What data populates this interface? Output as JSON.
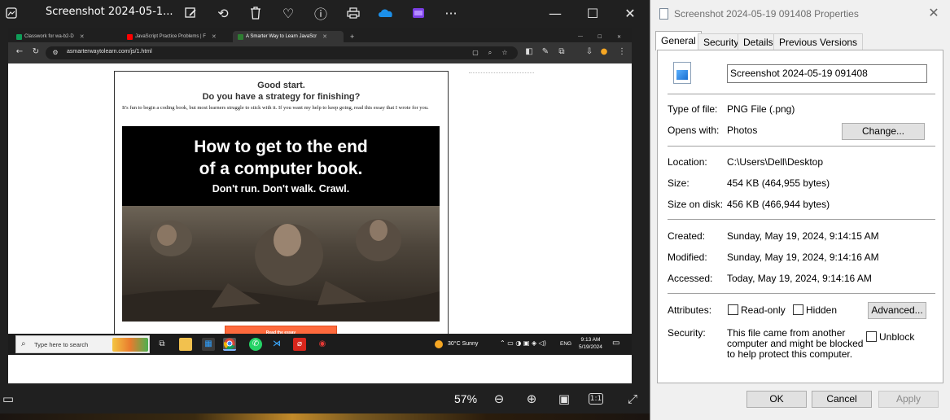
{
  "viewer": {
    "title": "Screenshot 2024-05-1...",
    "zoom": "57%",
    "icons": {
      "gallery": "gallery-icon",
      "edit": "edit-icon",
      "rotate": "rotate-icon",
      "delete": "delete-icon",
      "favorite": "heart-icon",
      "info": "info-icon",
      "print": "print-icon",
      "onedrive": "cloud-icon",
      "clipchamp": "clipchamp-icon",
      "more": "more-icon",
      "zoom_out": "zoom-out-icon",
      "zoom_in": "zoom-in-icon",
      "fit": "fit-icon",
      "actual_size": "actual-size-icon",
      "fullscreen": "fullscreen-icon",
      "filmstrip": "filmstrip-icon"
    },
    "actual_size_label": "1:1"
  },
  "browser": {
    "tabs": [
      {
        "label": "Classwork for wa-b2-D",
        "favicon_color": "#0f9d58"
      },
      {
        "label": "JavaScript Practice Problems | F",
        "favicon_color": "#ff0000"
      },
      {
        "label": "A Smarter Way to Learn JavaScr",
        "favicon_color": "#2e7d32"
      }
    ],
    "new_tab": "+",
    "url": "asmarterwaytolearn.com/js/1.html"
  },
  "webpage": {
    "heading1": "Good start.",
    "heading2": "Do you have a strategy for finishing?",
    "paragraph": "It's fun to begin a coding book, but most learners struggle to stick with it. If you want my help to keep going, read this essay that I wrote for you.",
    "banner_title_line1": "How to get to the end",
    "banner_title_line2": "of a computer book.",
    "banner_subtitle": "Don't run. Don't walk. Crawl.",
    "cta_button": "Read the essay",
    "cta_color": "#ff6a3d"
  },
  "taskbar": {
    "search_placeholder": "Type here to search",
    "weather": "30°C  Sunny",
    "language": "ENG",
    "time": "9:13 AM",
    "date": "5/19/2024"
  },
  "dialog": {
    "title": "Screenshot 2024-05-19 091408 Properties",
    "tabs": [
      "General",
      "Security",
      "Details",
      "Previous Versions"
    ],
    "file_name": "Screenshot 2024-05-19 091408",
    "type_label": "Type of file:",
    "type_value": "PNG File (.png)",
    "opens_label": "Opens with:",
    "opens_value": "Photos",
    "change_button": "Change...",
    "location_label": "Location:",
    "location_value": "C:\\Users\\Dell\\Desktop",
    "size_label": "Size:",
    "size_value": "454 KB (464,955 bytes)",
    "size_disk_label": "Size on disk:",
    "size_disk_value": "456 KB (466,944 bytes)",
    "created_label": "Created:",
    "created_value": "Sunday, May 19, 2024, 9:14:15 AM",
    "modified_label": "Modified:",
    "modified_value": "Sunday, May 19, 2024, 9:14:16 AM",
    "accessed_label": "Accessed:",
    "accessed_value": "Today, May 19, 2024, 9:14:16 AM",
    "attributes_label": "Attributes:",
    "readonly_label": "Read-only",
    "hidden_label": "Hidden",
    "advanced_button": "Advanced...",
    "security_label": "Security:",
    "security_text": "This file came from another computer and might be blocked to help protect this computer.",
    "unblock_label": "Unblock",
    "ok_button": "OK",
    "cancel_button": "Cancel",
    "apply_button": "Apply"
  }
}
